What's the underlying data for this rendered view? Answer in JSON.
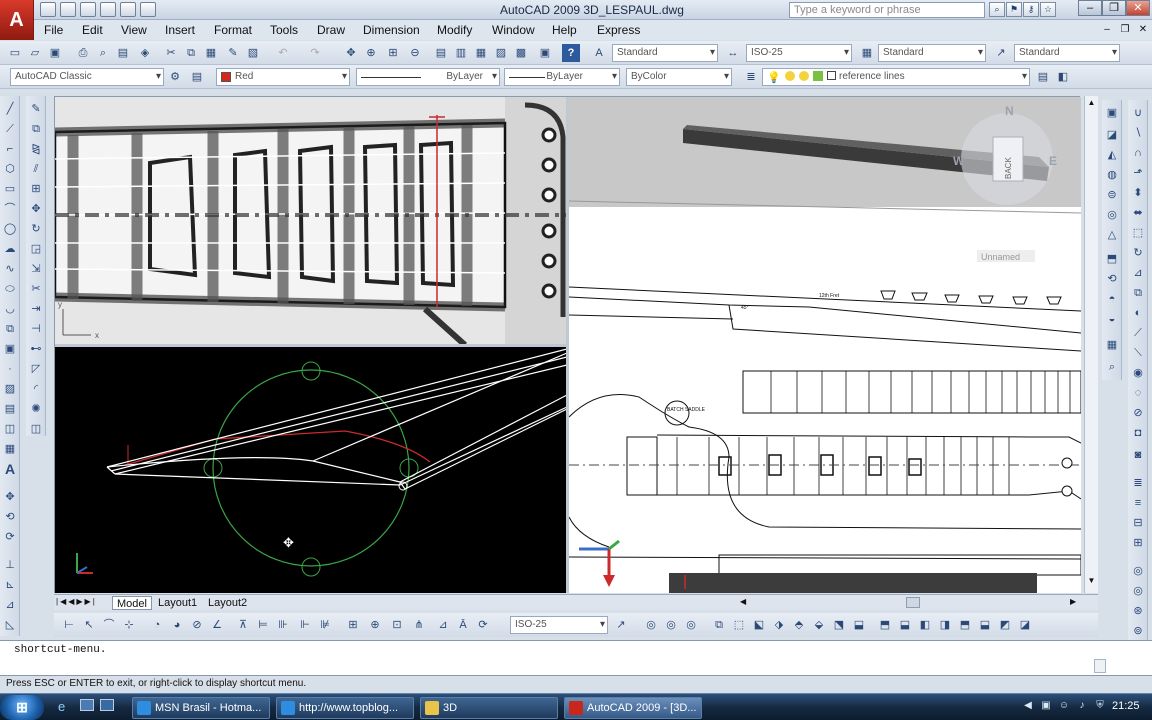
{
  "app": {
    "title": "AutoCAD 2009  3D_LESPAUL.dwg",
    "logo_label": "A",
    "search_placeholder": "Type a keyword or phrase"
  },
  "window_buttons": [
    "–",
    "❐",
    "✕"
  ],
  "menu": [
    "File",
    "Edit",
    "View",
    "Insert",
    "Format",
    "Tools",
    "Draw",
    "Dimension",
    "Modify",
    "Window",
    "Help",
    "Express"
  ],
  "styles": {
    "text_style": "Standard",
    "dim_style": "ISO-25",
    "table_style": "Standard",
    "multileader_style": "Standard"
  },
  "workspace": "AutoCAD Classic",
  "properties": {
    "color": "Red",
    "linetype": "ByLayer",
    "lineweight": "ByLayer",
    "plotstyle": "ByColor",
    "layer": "reference lines"
  },
  "viewports": {
    "top_left_ucs": [
      "y",
      "x"
    ],
    "right_view_label": "Unnamed",
    "compass": {
      "n": "N",
      "w": "W",
      "e": "E",
      "face": "BACK"
    }
  },
  "drawing_labels": {
    "fret_label": "12th Fret",
    "angle_label": "45°",
    "pickup_label": "BATCH SADDLE"
  },
  "layout_tabs": [
    "Model",
    "Layout1",
    "Layout2"
  ],
  "status_dimstyle": "ISO-25",
  "command_text": "shortcut-menu.",
  "prompt_text": "Press ESC or ENTER to exit, or right-click to display shortcut menu.",
  "taskbar": {
    "items": [
      {
        "label": "MSN Brasil - Hotma...",
        "color": "#2f8de0"
      },
      {
        "label": "http://www.topblog...",
        "color": "#2f8de0"
      },
      {
        "label": "3D",
        "color": "#e8c44a"
      },
      {
        "label": "AutoCAD 2009 - [3D...",
        "color": "#c8281c"
      }
    ],
    "clock": "21:25",
    "start_label": "⊞"
  },
  "colors": {
    "accent": "#c8281c",
    "drawing_bg_dark": "#000000",
    "selection_red": "#cc2a2a",
    "circle_green": "#3aa646"
  }
}
